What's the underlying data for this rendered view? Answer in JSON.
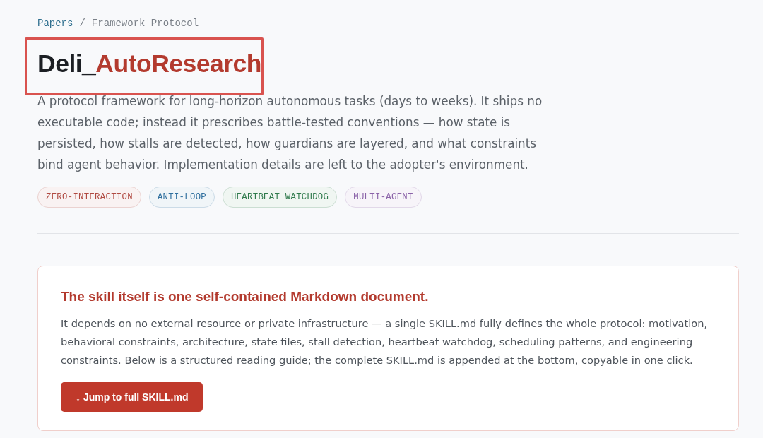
{
  "breadcrumb": {
    "separator": "/",
    "items": [
      {
        "label": "Papers",
        "kind": "link"
      },
      {
        "label": "Framework Protocol",
        "kind": "current"
      }
    ]
  },
  "title": {
    "lead": "Deli_",
    "accent": "AutoResearch",
    "highlighted": true
  },
  "summary": "A protocol framework for long-horizon autonomous tasks (days to weeks). It ships no executable code; instead it prescribes battle-tested conventions — how state is persisted, how stalls are detected, how guardians are layered, and what constraints bind agent behavior. Implementation details are left to the adopter's environment.",
  "tags": [
    {
      "label": "ZERO-INTERACTION",
      "color": "#b04a42"
    },
    {
      "label": "ANTI-LOOP",
      "color": "#2f6f9e"
    },
    {
      "label": "HEARTBEAT WATCHDOG",
      "color": "#2f7a4c"
    },
    {
      "label": "MULTI-AGENT",
      "color": "#8a62a8"
    }
  ],
  "callout": {
    "heading": "The skill itself is one self-contained Markdown document.",
    "body": "It depends on no external resource or private infrastructure — a single SKILL.md fully defines the whole protocol: motivation, behavioral constraints, architecture, state files, stall detection, heartbeat watchdog, scheduling patterns, and engineering constraints. Below is a structured reading guide; the complete SKILL.md is appended at the bottom, copyable in one click.",
    "button": "↓ Jump to full SKILL.md"
  }
}
